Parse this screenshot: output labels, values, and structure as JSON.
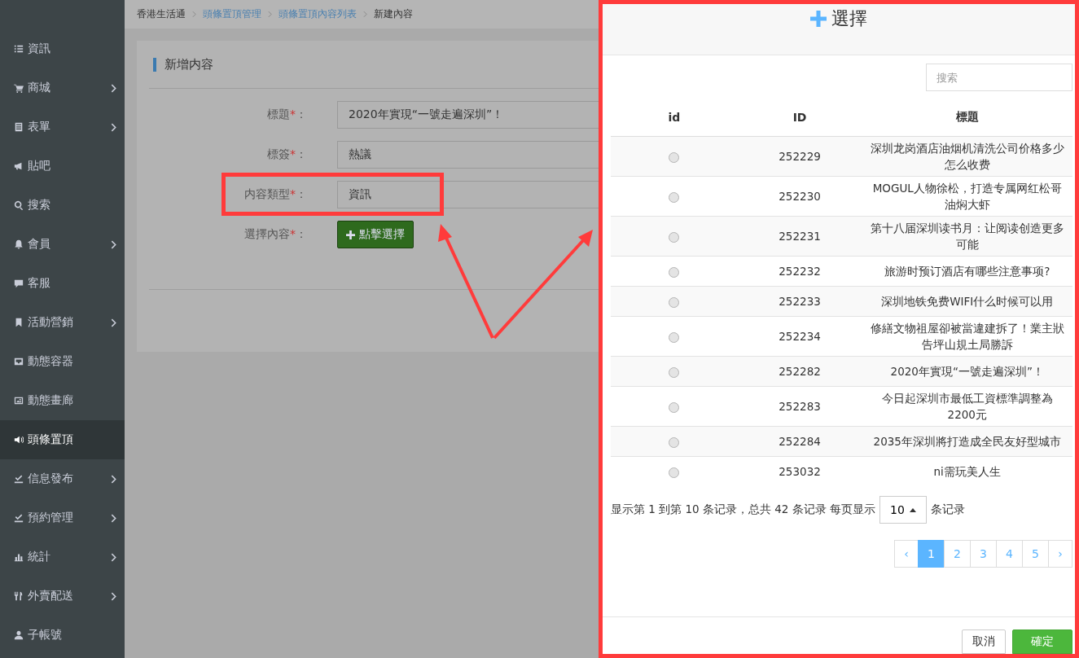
{
  "sidebar": {
    "items": [
      {
        "label": "資訊",
        "has_submenu": false,
        "selected": false
      },
      {
        "label": "商城",
        "has_submenu": true,
        "selected": false
      },
      {
        "label": "表單",
        "has_submenu": true,
        "selected": false
      },
      {
        "label": "貼吧",
        "has_submenu": false,
        "selected": false
      },
      {
        "label": "搜索",
        "has_submenu": false,
        "selected": false
      },
      {
        "label": "會員",
        "has_submenu": true,
        "selected": false
      },
      {
        "label": "客服",
        "has_submenu": false,
        "selected": false
      },
      {
        "label": "活動營銷",
        "has_submenu": true,
        "selected": false
      },
      {
        "label": "動態容器",
        "has_submenu": false,
        "selected": false
      },
      {
        "label": "動態畫廊",
        "has_submenu": false,
        "selected": false
      },
      {
        "label": "頭條置頂",
        "has_submenu": false,
        "selected": true
      },
      {
        "label": "信息發布",
        "has_submenu": true,
        "selected": false
      },
      {
        "label": "預約管理",
        "has_submenu": true,
        "selected": false
      },
      {
        "label": "統計",
        "has_submenu": true,
        "selected": false
      },
      {
        "label": "外賣配送",
        "has_submenu": true,
        "selected": false
      },
      {
        "label": "子帳號",
        "has_submenu": false,
        "selected": false
      }
    ]
  },
  "breadcrumb": [
    {
      "label": "香港生活通",
      "link": false
    },
    {
      "label": "頭條置頂管理",
      "link": true
    },
    {
      "label": "頭條置頂內容列表",
      "link": true
    },
    {
      "label": "新建內容",
      "link": false
    }
  ],
  "form": {
    "heading": "新增内容",
    "fields": [
      {
        "kind": "input",
        "label": "標題",
        "required_mark": "*",
        "colon": "：",
        "value": "2020年實現“一號走遍深圳”！"
      },
      {
        "kind": "input",
        "label": "標簽",
        "required_mark": "*",
        "colon": "：",
        "value": "熱議"
      },
      {
        "kind": "input",
        "label": "内容類型",
        "required_mark": "*",
        "colon": "：",
        "value": "資訊"
      },
      {
        "kind": "button",
        "label": "選擇內容",
        "required_mark": "*",
        "colon": "：",
        "value": "點擊選擇"
      }
    ]
  },
  "modal": {
    "title": "選擇",
    "search": {
      "placeholder": "搜索"
    },
    "columns": [
      "id",
      "ID",
      "標題"
    ],
    "rows": [
      {
        "id": "252229",
        "title": "深圳龙岗酒店油烟机清洗公司价格多少怎么收费",
        "selected": false
      },
      {
        "id": "252230",
        "title": "MOGUL人物徐松，打造专属网红松哥油焖大虾",
        "selected": false
      },
      {
        "id": "252231",
        "title": "第十八届深圳读书月：让阅读创造更多可能",
        "selected": false
      },
      {
        "id": "252232",
        "title": "旅游时预订酒店有哪些注意事项?",
        "selected": false
      },
      {
        "id": "252233",
        "title": "深圳地铁免费WIFI什么时候可以用",
        "selected": false
      },
      {
        "id": "252234",
        "title": "修繕文物祖屋卻被當違建拆了！業主狀告坪山規土局勝訴",
        "selected": false
      },
      {
        "id": "252282",
        "title": "2020年實現“一號走遍深圳”！",
        "selected": false
      },
      {
        "id": "252283",
        "title": "今日起深圳市最低工資標準調整為2200元",
        "selected": false
      },
      {
        "id": "252284",
        "title": "2035年深圳將打造成全民友好型城市",
        "selected": false
      },
      {
        "id": "253032",
        "title": "ni需玩美人生",
        "selected": false
      }
    ],
    "summary": "显示第 1 到第 10 条记录，总共 42 条记录 每页显示",
    "page_size": "10",
    "page_size_suffix": "条记录",
    "pages": [
      {
        "label": "‹",
        "kind": "prev",
        "selected": false
      },
      {
        "label": "1",
        "kind": "page",
        "selected": true
      },
      {
        "label": "2",
        "kind": "page",
        "selected": false
      },
      {
        "label": "3",
        "kind": "page",
        "selected": false
      },
      {
        "label": "4",
        "kind": "page",
        "selected": false
      },
      {
        "label": "5",
        "kind": "page",
        "selected": false
      },
      {
        "label": "›",
        "kind": "next",
        "selected": false
      }
    ],
    "buttons": [
      {
        "label": "取消",
        "kind": "default"
      },
      {
        "label": "確定",
        "kind": "primary"
      }
    ]
  }
}
